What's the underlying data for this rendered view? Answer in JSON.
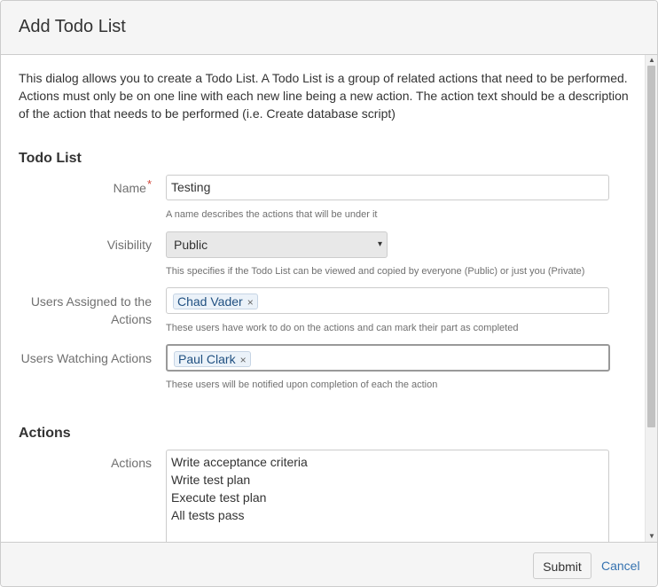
{
  "dialog": {
    "title": "Add Todo List",
    "intro": "This dialog allows you to create a Todo List. A Todo List is a group of related actions that need to be performed. Actions must only be on one line with each new line being a new action. The action text should be a description of the action that needs to be performed (i.e. Create database script)"
  },
  "todo_section": {
    "heading": "Todo List",
    "name": {
      "label": "Name",
      "required_marker": "*",
      "value": "Testing",
      "help": "A name describes the actions that will be under it"
    },
    "visibility": {
      "label": "Visibility",
      "selected": "Public",
      "caret": "▾",
      "help": "This specifies if the Todo List can be viewed and copied by everyone (Public) or just you (Private)"
    },
    "assigned": {
      "label_line1": "Users Assigned to the",
      "label_line2": "Actions",
      "tags": [
        "Chad Vader"
      ],
      "remove_glyph": "×",
      "help": "These users have work to do on the actions and can mark their part as completed"
    },
    "watching": {
      "label": "Users Watching Actions",
      "tags": [
        "Paul Clark"
      ],
      "remove_glyph": "×",
      "help": "These users will be notified upon completion of each the action"
    }
  },
  "actions_section": {
    "heading": "Actions",
    "label": "Actions",
    "lines": [
      "Write acceptance criteria",
      "Write test plan",
      "Execute test plan",
      "All tests pass"
    ]
  },
  "footer": {
    "submit_label": "Submit",
    "cancel_label": "Cancel"
  },
  "scrollbar": {
    "up_glyph": "▲",
    "down_glyph": "▼"
  },
  "colors": {
    "link": "#3572b0",
    "required": "#d04437",
    "tag_bg": "#ebf2f9",
    "tag_text": "#205081"
  }
}
